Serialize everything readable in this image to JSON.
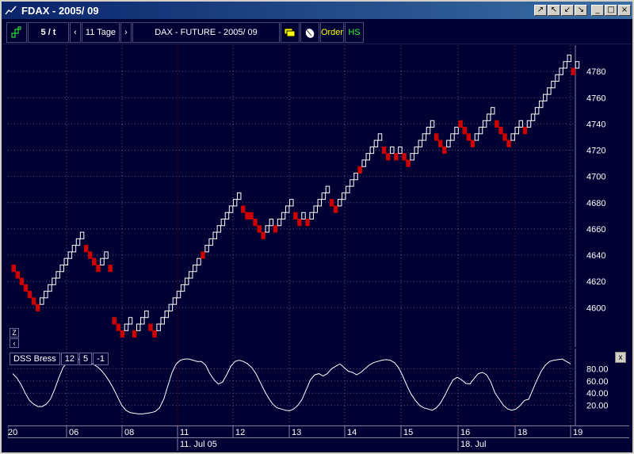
{
  "window": {
    "title": "FDAX - 2005/ 09",
    "buttons": [
      "↗",
      "↖",
      "↙",
      "↘",
      "_",
      "□",
      "×"
    ]
  },
  "toolbar": {
    "chart_type_icon": "renko-icon",
    "interval": "5 / t",
    "prev_label": "‹",
    "range": "11 Tage",
    "next_label": "›",
    "instrument": "DAX - FUTURE - 2005/ 09",
    "order_label": "Order",
    "hs_label": "HS"
  },
  "indicator": {
    "name": "DSS Bress",
    "params": [
      "12",
      "5",
      "-1"
    ],
    "close_label": "x",
    "axis_labels": [
      "80.00",
      "60.00",
      "40.00",
      "20.00"
    ]
  },
  "chart_controls": {
    "zoom_label": "Z",
    "back_label": "‹"
  },
  "chart_data": {
    "type": "renko",
    "title": "DAX - FUTURE - 2005/ 09",
    "box_size": 5,
    "ylim": [
      4570,
      4800
    ],
    "y_ticks": [
      4600,
      4620,
      4640,
      4660,
      4680,
      4700,
      4720,
      4740,
      4760,
      4780
    ],
    "x_ticks": [
      "06",
      "08",
      "11",
      "12",
      "13",
      "14",
      "15",
      "16",
      "18",
      "19",
      "20"
    ],
    "date_labels": [
      "11. Jul 05",
      "18. Jul"
    ],
    "colors": {
      "up": "#ffffff",
      "down": "#cc0000",
      "background": "#000033",
      "grid": "#5a5a8a",
      "session": "#aa0000"
    },
    "bricks": [
      {
        "i": 0,
        "v": 4630,
        "d": "down"
      },
      {
        "i": 1,
        "v": 4625,
        "d": "down"
      },
      {
        "i": 2,
        "v": 4620,
        "d": "down"
      },
      {
        "i": 3,
        "v": 4615,
        "d": "down"
      },
      {
        "i": 4,
        "v": 4610,
        "d": "down"
      },
      {
        "i": 5,
        "v": 4605,
        "d": "down"
      },
      {
        "i": 6,
        "v": 4600,
        "d": "down"
      },
      {
        "i": 7,
        "v": 4605,
        "d": "up"
      },
      {
        "i": 8,
        "v": 4610,
        "d": "up"
      },
      {
        "i": 9,
        "v": 4615,
        "d": "up"
      },
      {
        "i": 10,
        "v": 4620,
        "d": "up"
      },
      {
        "i": 11,
        "v": 4625,
        "d": "up"
      },
      {
        "i": 12,
        "v": 4630,
        "d": "up"
      },
      {
        "i": 13,
        "v": 4635,
        "d": "up"
      },
      {
        "i": 14,
        "v": 4640,
        "d": "up"
      },
      {
        "i": 15,
        "v": 4645,
        "d": "up"
      },
      {
        "i": 16,
        "v": 4650,
        "d": "up"
      },
      {
        "i": 17,
        "v": 4655,
        "d": "up"
      },
      {
        "i": 18,
        "v": 4645,
        "d": "down"
      },
      {
        "i": 19,
        "v": 4640,
        "d": "down"
      },
      {
        "i": 20,
        "v": 4635,
        "d": "down"
      },
      {
        "i": 21,
        "v": 4630,
        "d": "down"
      },
      {
        "i": 22,
        "v": 4635,
        "d": "up"
      },
      {
        "i": 23,
        "v": 4640,
        "d": "up"
      },
      {
        "i": 24,
        "v": 4630,
        "d": "down"
      },
      {
        "i": 25,
        "v": 4590,
        "d": "down"
      },
      {
        "i": 26,
        "v": 4585,
        "d": "down"
      },
      {
        "i": 27,
        "v": 4580,
        "d": "down"
      },
      {
        "i": 28,
        "v": 4585,
        "d": "up"
      },
      {
        "i": 29,
        "v": 4590,
        "d": "up"
      },
      {
        "i": 30,
        "v": 4580,
        "d": "down"
      },
      {
        "i": 31,
        "v": 4585,
        "d": "up"
      },
      {
        "i": 32,
        "v": 4590,
        "d": "up"
      },
      {
        "i": 33,
        "v": 4595,
        "d": "up"
      },
      {
        "i": 34,
        "v": 4585,
        "d": "down"
      },
      {
        "i": 35,
        "v": 4580,
        "d": "down"
      },
      {
        "i": 36,
        "v": 4585,
        "d": "up"
      },
      {
        "i": 37,
        "v": 4590,
        "d": "up"
      },
      {
        "i": 38,
        "v": 4595,
        "d": "up"
      },
      {
        "i": 39,
        "v": 4600,
        "d": "up"
      },
      {
        "i": 40,
        "v": 4605,
        "d": "up"
      },
      {
        "i": 41,
        "v": 4610,
        "d": "up"
      },
      {
        "i": 42,
        "v": 4615,
        "d": "up"
      },
      {
        "i": 43,
        "v": 4620,
        "d": "up"
      },
      {
        "i": 44,
        "v": 4625,
        "d": "up"
      },
      {
        "i": 45,
        "v": 4630,
        "d": "up"
      },
      {
        "i": 46,
        "v": 4635,
        "d": "up"
      },
      {
        "i": 47,
        "v": 4640,
        "d": "down"
      },
      {
        "i": 48,
        "v": 4645,
        "d": "up"
      },
      {
        "i": 49,
        "v": 4650,
        "d": "up"
      },
      {
        "i": 50,
        "v": 4655,
        "d": "up"
      },
      {
        "i": 51,
        "v": 4660,
        "d": "up"
      },
      {
        "i": 52,
        "v": 4665,
        "d": "up"
      },
      {
        "i": 53,
        "v": 4670,
        "d": "up"
      },
      {
        "i": 54,
        "v": 4675,
        "d": "up"
      },
      {
        "i": 55,
        "v": 4680,
        "d": "up"
      },
      {
        "i": 56,
        "v": 4685,
        "d": "up"
      },
      {
        "i": 57,
        "v": 4675,
        "d": "down"
      },
      {
        "i": 58,
        "v": 4670,
        "d": "down"
      },
      {
        "i": 59,
        "v": 4670,
        "d": "down"
      },
      {
        "i": 60,
        "v": 4665,
        "d": "down"
      },
      {
        "i": 61,
        "v": 4660,
        "d": "down"
      },
      {
        "i": 62,
        "v": 4655,
        "d": "down"
      },
      {
        "i": 63,
        "v": 4660,
        "d": "up"
      },
      {
        "i": 64,
        "v": 4665,
        "d": "up"
      },
      {
        "i": 65,
        "v": 4660,
        "d": "down"
      },
      {
        "i": 66,
        "v": 4665,
        "d": "up"
      },
      {
        "i": 67,
        "v": 4670,
        "d": "up"
      },
      {
        "i": 68,
        "v": 4675,
        "d": "up"
      },
      {
        "i": 69,
        "v": 4680,
        "d": "up"
      },
      {
        "i": 70,
        "v": 4670,
        "d": "down"
      },
      {
        "i": 71,
        "v": 4665,
        "d": "down"
      },
      {
        "i": 72,
        "v": 4670,
        "d": "up"
      },
      {
        "i": 73,
        "v": 4665,
        "d": "down"
      },
      {
        "i": 74,
        "v": 4670,
        "d": "up"
      },
      {
        "i": 75,
        "v": 4675,
        "d": "up"
      },
      {
        "i": 76,
        "v": 4680,
        "d": "up"
      },
      {
        "i": 77,
        "v": 4685,
        "d": "up"
      },
      {
        "i": 78,
        "v": 4690,
        "d": "up"
      },
      {
        "i": 79,
        "v": 4680,
        "d": "down"
      },
      {
        "i": 80,
        "v": 4675,
        "d": "down"
      },
      {
        "i": 81,
        "v": 4680,
        "d": "up"
      },
      {
        "i": 82,
        "v": 4685,
        "d": "up"
      },
      {
        "i": 83,
        "v": 4690,
        "d": "up"
      },
      {
        "i": 84,
        "v": 4695,
        "d": "up"
      },
      {
        "i": 85,
        "v": 4700,
        "d": "up"
      },
      {
        "i": 86,
        "v": 4705,
        "d": "down"
      },
      {
        "i": 87,
        "v": 4710,
        "d": "up"
      },
      {
        "i": 88,
        "v": 4715,
        "d": "up"
      },
      {
        "i": 89,
        "v": 4720,
        "d": "up"
      },
      {
        "i": 90,
        "v": 4725,
        "d": "up"
      },
      {
        "i": 91,
        "v": 4730,
        "d": "up"
      },
      {
        "i": 92,
        "v": 4720,
        "d": "down"
      },
      {
        "i": 93,
        "v": 4715,
        "d": "down"
      },
      {
        "i": 94,
        "v": 4720,
        "d": "up"
      },
      {
        "i": 95,
        "v": 4715,
        "d": "down"
      },
      {
        "i": 96,
        "v": 4720,
        "d": "up"
      },
      {
        "i": 97,
        "v": 4715,
        "d": "down"
      },
      {
        "i": 98,
        "v": 4710,
        "d": "down"
      },
      {
        "i": 99,
        "v": 4715,
        "d": "up"
      },
      {
        "i": 100,
        "v": 4720,
        "d": "up"
      },
      {
        "i": 101,
        "v": 4725,
        "d": "up"
      },
      {
        "i": 102,
        "v": 4730,
        "d": "up"
      },
      {
        "i": 103,
        "v": 4735,
        "d": "up"
      },
      {
        "i": 104,
        "v": 4740,
        "d": "up"
      },
      {
        "i": 105,
        "v": 4730,
        "d": "down"
      },
      {
        "i": 106,
        "v": 4725,
        "d": "down"
      },
      {
        "i": 107,
        "v": 4720,
        "d": "down"
      },
      {
        "i": 108,
        "v": 4725,
        "d": "up"
      },
      {
        "i": 109,
        "v": 4730,
        "d": "up"
      },
      {
        "i": 110,
        "v": 4735,
        "d": "up"
      },
      {
        "i": 111,
        "v": 4740,
        "d": "down"
      },
      {
        "i": 112,
        "v": 4735,
        "d": "down"
      },
      {
        "i": 113,
        "v": 4730,
        "d": "down"
      },
      {
        "i": 114,
        "v": 4725,
        "d": "down"
      },
      {
        "i": 115,
        "v": 4730,
        "d": "up"
      },
      {
        "i": 116,
        "v": 4735,
        "d": "up"
      },
      {
        "i": 117,
        "v": 4740,
        "d": "up"
      },
      {
        "i": 118,
        "v": 4745,
        "d": "up"
      },
      {
        "i": 119,
        "v": 4750,
        "d": "up"
      },
      {
        "i": 120,
        "v": 4740,
        "d": "down"
      },
      {
        "i": 121,
        "v": 4735,
        "d": "down"
      },
      {
        "i": 122,
        "v": 4730,
        "d": "down"
      },
      {
        "i": 123,
        "v": 4725,
        "d": "down"
      },
      {
        "i": 124,
        "v": 4730,
        "d": "up"
      },
      {
        "i": 125,
        "v": 4735,
        "d": "up"
      },
      {
        "i": 126,
        "v": 4740,
        "d": "up"
      },
      {
        "i": 127,
        "v": 4735,
        "d": "down"
      },
      {
        "i": 128,
        "v": 4740,
        "d": "up"
      },
      {
        "i": 129,
        "v": 4745,
        "d": "up"
      },
      {
        "i": 130,
        "v": 4750,
        "d": "up"
      },
      {
        "i": 131,
        "v": 4755,
        "d": "up"
      },
      {
        "i": 132,
        "v": 4760,
        "d": "up"
      },
      {
        "i": 133,
        "v": 4765,
        "d": "up"
      },
      {
        "i": 134,
        "v": 4770,
        "d": "up"
      },
      {
        "i": 135,
        "v": 4775,
        "d": "up"
      },
      {
        "i": 136,
        "v": 4780,
        "d": "up"
      },
      {
        "i": 137,
        "v": 4785,
        "d": "up"
      },
      {
        "i": 138,
        "v": 4790,
        "d": "up"
      },
      {
        "i": 139,
        "v": 4780,
        "d": "down"
      },
      {
        "i": 140,
        "v": 4785,
        "d": "up"
      }
    ],
    "dss_series": [
      72,
      65,
      54,
      40,
      28,
      22,
      18,
      18,
      22,
      30,
      46,
      65,
      82,
      90,
      94,
      96,
      95,
      92,
      90,
      88,
      84,
      78,
      70,
      60,
      48,
      34,
      20,
      12,
      8,
      7,
      6,
      6,
      7,
      8,
      10,
      16,
      30,
      52,
      74,
      88,
      94,
      96,
      96,
      94,
      92,
      92,
      86,
      72,
      62,
      55,
      58,
      70,
      84,
      92,
      94,
      92,
      88,
      82,
      72,
      58,
      44,
      32,
      22,
      16,
      14,
      12,
      11,
      14,
      20,
      30,
      46,
      62,
      70,
      72,
      68,
      72,
      80,
      84,
      88,
      82,
      76,
      74,
      70,
      74,
      80,
      86,
      90,
      92,
      94,
      95,
      94,
      90,
      82,
      68,
      52,
      38,
      28,
      20,
      16,
      14,
      12,
      16,
      24,
      36,
      50,
      62,
      66,
      62,
      56,
      55,
      64,
      72,
      74,
      70,
      58,
      40,
      30,
      20,
      14,
      12,
      14,
      20,
      28,
      30,
      46,
      62,
      76,
      86,
      92,
      94,
      95,
      96,
      92,
      88
    ]
  }
}
